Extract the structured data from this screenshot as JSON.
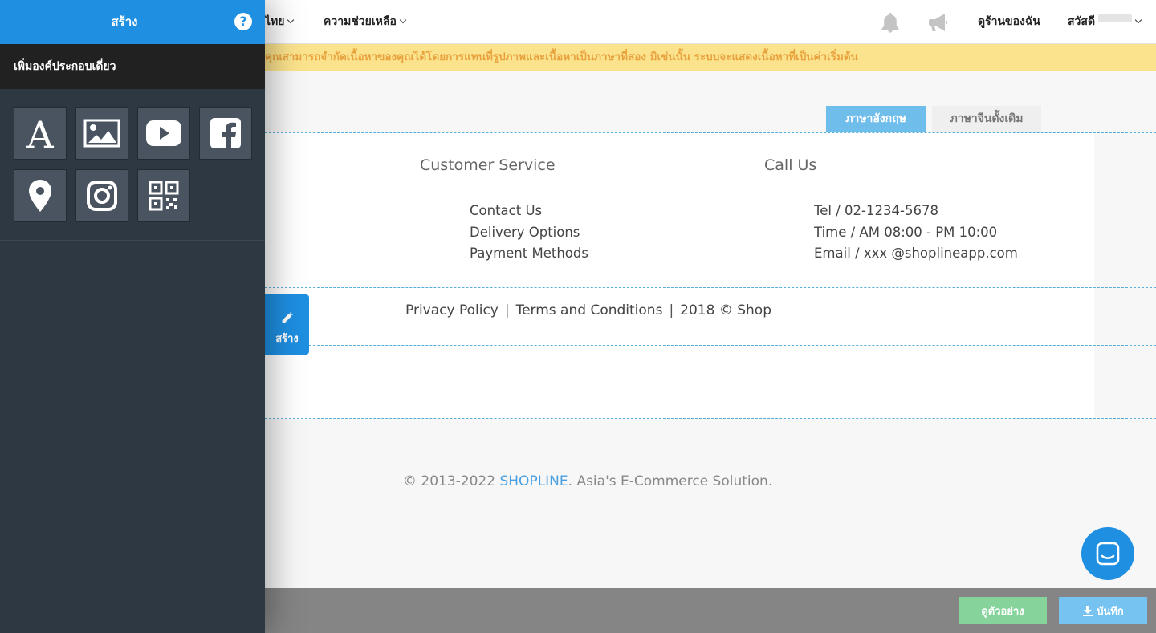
{
  "topnav": {
    "lang_label": "ไทย",
    "help_label": "ความช่วยเหลือ",
    "my_store_label": "ดูร้านของฉัน",
    "greeting": "สวัสดี"
  },
  "notice": {
    "text": "คุณสามารถจำกัดเนื้อหาของคุณได้โดยการแทนที่รูปภาพและเนื้อหาเป็นภาษาที่สอง มิเช่นนั้น ระบบจะแสดงเนื้อหาที่เป็นค่าเริ่มต้น"
  },
  "language_tabs": [
    {
      "label": "ภาษาอังกฤษ",
      "active": true
    },
    {
      "label": "ภาษาจีนดั้งเดิม",
      "active": false
    }
  ],
  "footer": {
    "customer_service": {
      "title": "Customer Service",
      "links": [
        "Contact Us",
        "Delivery Options",
        "Payment Methods"
      ]
    },
    "call_us": {
      "title": "Call Us",
      "lines": [
        "Tel / 02-1234-5678",
        "Time / AM 08:00 - PM 10:00",
        "Email / xxx @shoplineapp.com"
      ]
    },
    "policy": {
      "privacy": "Privacy Policy",
      "terms": "Terms and Conditions",
      "copyright": "2018 © Shop"
    }
  },
  "edit_tab": {
    "label": "สร้าง"
  },
  "site_copyright": {
    "prefix": "© 2013-2022 ",
    "brand": "SHOPLINE",
    "suffix": ". Asia's E-Commerce Solution."
  },
  "bottombar": {
    "preview_label": "ดูตัวอย่าง",
    "save_label": "บันทึก"
  },
  "panel": {
    "title": "สร้าง",
    "help_glyph": "?",
    "subheading": "เพิ่มองค์ประกอบเดี่ยว",
    "tiles": [
      "text-icon",
      "image-icon",
      "youtube-icon",
      "facebook-icon",
      "map-marker-icon",
      "instagram-icon",
      "qr-code-icon"
    ]
  },
  "colors": {
    "primary": "#1e8fe1",
    "panel_bg": "#2e3843",
    "notice_bg": "#fbe38d",
    "notice_text": "#e8a23d",
    "preview_btn": "#86d49b",
    "save_btn": "#76c2f0"
  }
}
